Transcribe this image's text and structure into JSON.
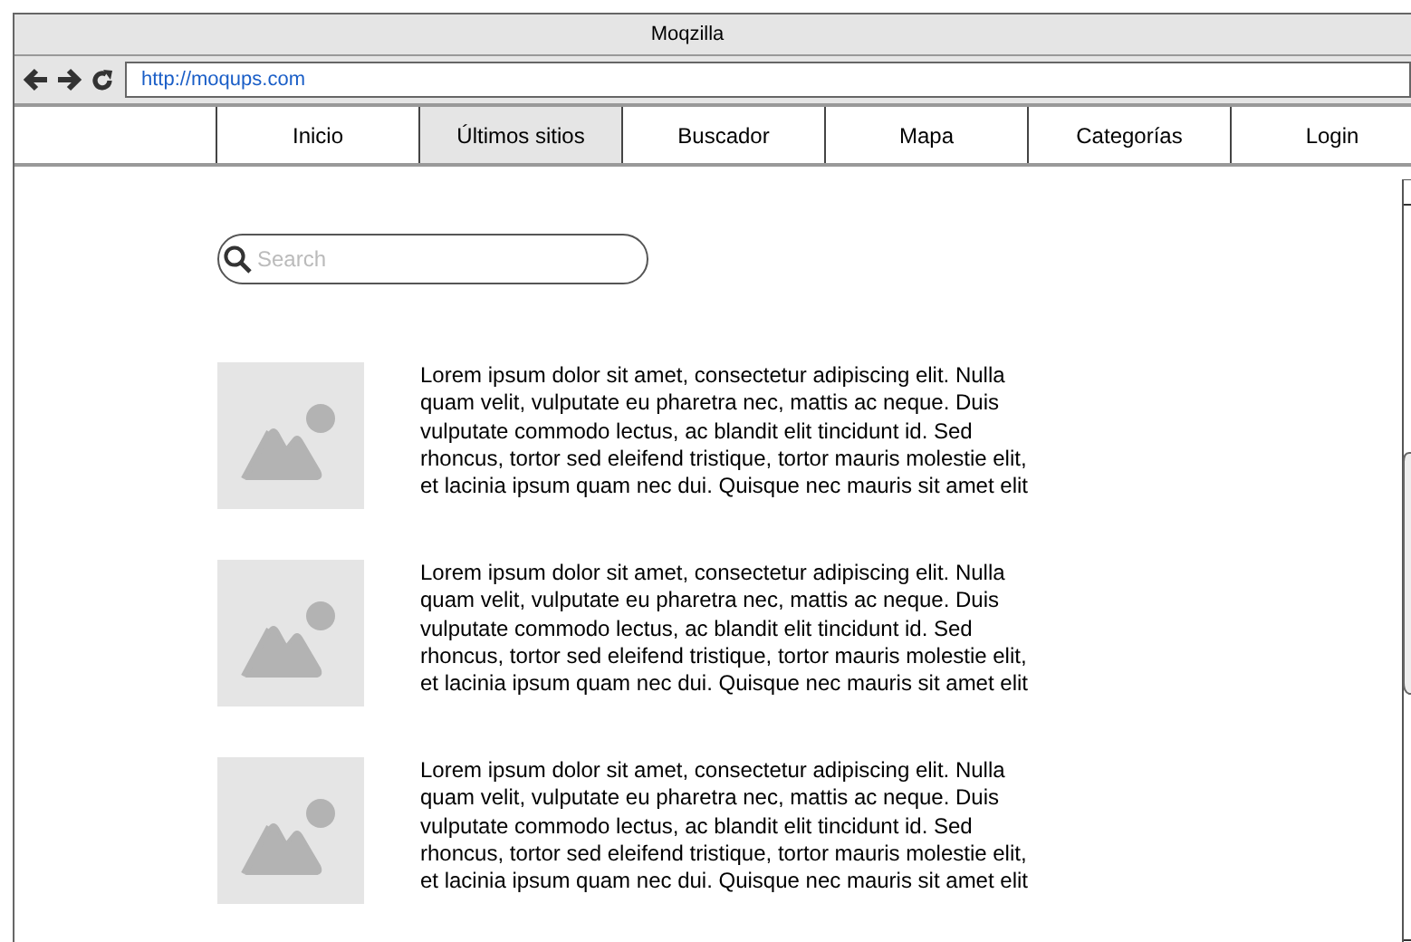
{
  "window": {
    "title": "Moqzilla"
  },
  "address_bar": {
    "url": "http://moqups.com"
  },
  "nav": [
    {
      "label": "Inicio",
      "selected": false
    },
    {
      "label": "Últimos sitios",
      "selected": true
    },
    {
      "label": "Buscador",
      "selected": false
    },
    {
      "label": "Mapa",
      "selected": false
    },
    {
      "label": "Categorías",
      "selected": false
    },
    {
      "label": "Login",
      "selected": false
    }
  ],
  "search": {
    "placeholder": "Search"
  },
  "results": [
    {
      "text": "Lorem ipsum dolor sit amet, consectetur adipiscing elit. Nulla quam velit, vulputate eu pharetra nec, mattis ac neque. Duis vulputate commodo lectus, ac blandit elit tincidunt id. Sed rhoncus, tortor sed eleifend tristique, tortor mauris molestie elit, et lacinia ipsum quam nec dui. Quisque nec mauris sit amet elit"
    },
    {
      "text": "Lorem ipsum dolor sit amet, consectetur adipiscing elit. Nulla quam velit, vulputate eu pharetra nec, mattis ac neque. Duis vulputate commodo lectus, ac blandit elit tincidunt id. Sed rhoncus, tortor sed eleifend tristique, tortor mauris molestie elit, et lacinia ipsum quam nec dui. Quisque nec mauris sit amet elit"
    },
    {
      "text": "Lorem ipsum dolor sit amet, consectetur adipiscing elit. Nulla quam velit, vulputate eu pharetra nec, mattis ac neque. Duis vulputate commodo lectus, ac blandit elit tincidunt id. Sed rhoncus, tortor sed eleifend tristique, tortor mauris molestie elit, et lacinia ipsum quam nec dui. Quisque nec mauris sit amet elit"
    }
  ]
}
